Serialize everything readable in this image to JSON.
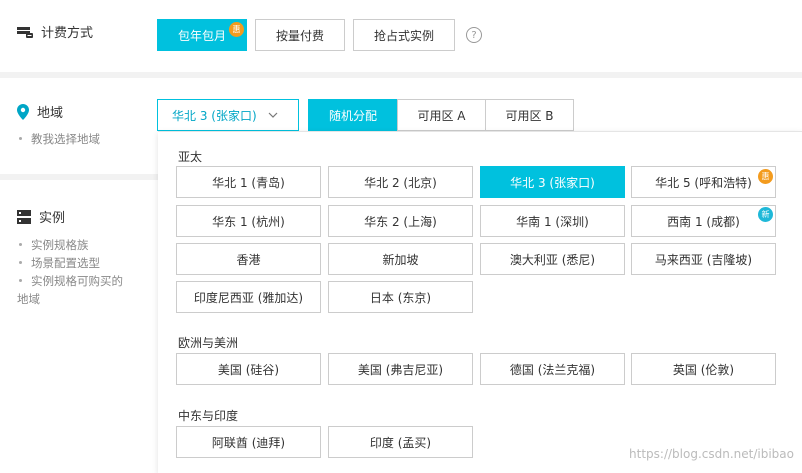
{
  "billing": {
    "label": "计费方式",
    "icon": "billing-icon",
    "options": [
      {
        "label": "包年包月",
        "active": true,
        "badge": "惠"
      },
      {
        "label": "按量付费",
        "active": false
      },
      {
        "label": "抢占式实例",
        "active": false
      }
    ],
    "help": "?"
  },
  "region": {
    "label": "地域",
    "icon": "location-pin-icon",
    "help_link": "教我选择地域",
    "selected": "华北 3 (张家口)",
    "zones": [
      {
        "label": "随机分配",
        "active": true
      },
      {
        "label": "可用区 A",
        "active": false
      },
      {
        "label": "可用区 B",
        "active": false
      }
    ]
  },
  "instance": {
    "label": "实例",
    "icon": "server-icon",
    "links": [
      "实例规格族",
      "场景配置选型",
      "实例规格可购买的",
      "地域"
    ]
  },
  "dropdown": {
    "groups": [
      {
        "title": "亚太",
        "options": [
          {
            "label": "华北 1 (青岛)"
          },
          {
            "label": "华北 2 (北京)"
          },
          {
            "label": "华北 3 (张家口)",
            "active": true
          },
          {
            "label": "华北 5 (呼和浩特)",
            "badge": "惠"
          },
          {
            "label": "华东 1 (杭州)"
          },
          {
            "label": "华东 2 (上海)"
          },
          {
            "label": "华南 1 (深圳)"
          },
          {
            "label": "西南 1 (成都)",
            "badge": "新"
          },
          {
            "label": "香港"
          },
          {
            "label": "新加坡"
          },
          {
            "label": "澳大利亚 (悉尼)"
          },
          {
            "label": "马来西亚 (吉隆坡)"
          },
          {
            "label": "印度尼西亚 (雅加达)"
          },
          {
            "label": "日本 (东京)"
          }
        ]
      },
      {
        "title": "欧洲与美洲",
        "options": [
          {
            "label": "美国 (硅谷)"
          },
          {
            "label": "美国 (弗吉尼亚)"
          },
          {
            "label": "德国 (法兰克福)"
          },
          {
            "label": "英国 (伦敦)"
          }
        ]
      },
      {
        "title": "中东与印度",
        "options": [
          {
            "label": "阿联酋 (迪拜)"
          },
          {
            "label": "印度 (孟买)"
          }
        ]
      }
    ]
  },
  "watermark": "https://blog.csdn.net/ibibao",
  "colors": {
    "accent": "#00c1de",
    "hot_badge": "#f39b1e",
    "new_badge": "#1fb8d8"
  }
}
